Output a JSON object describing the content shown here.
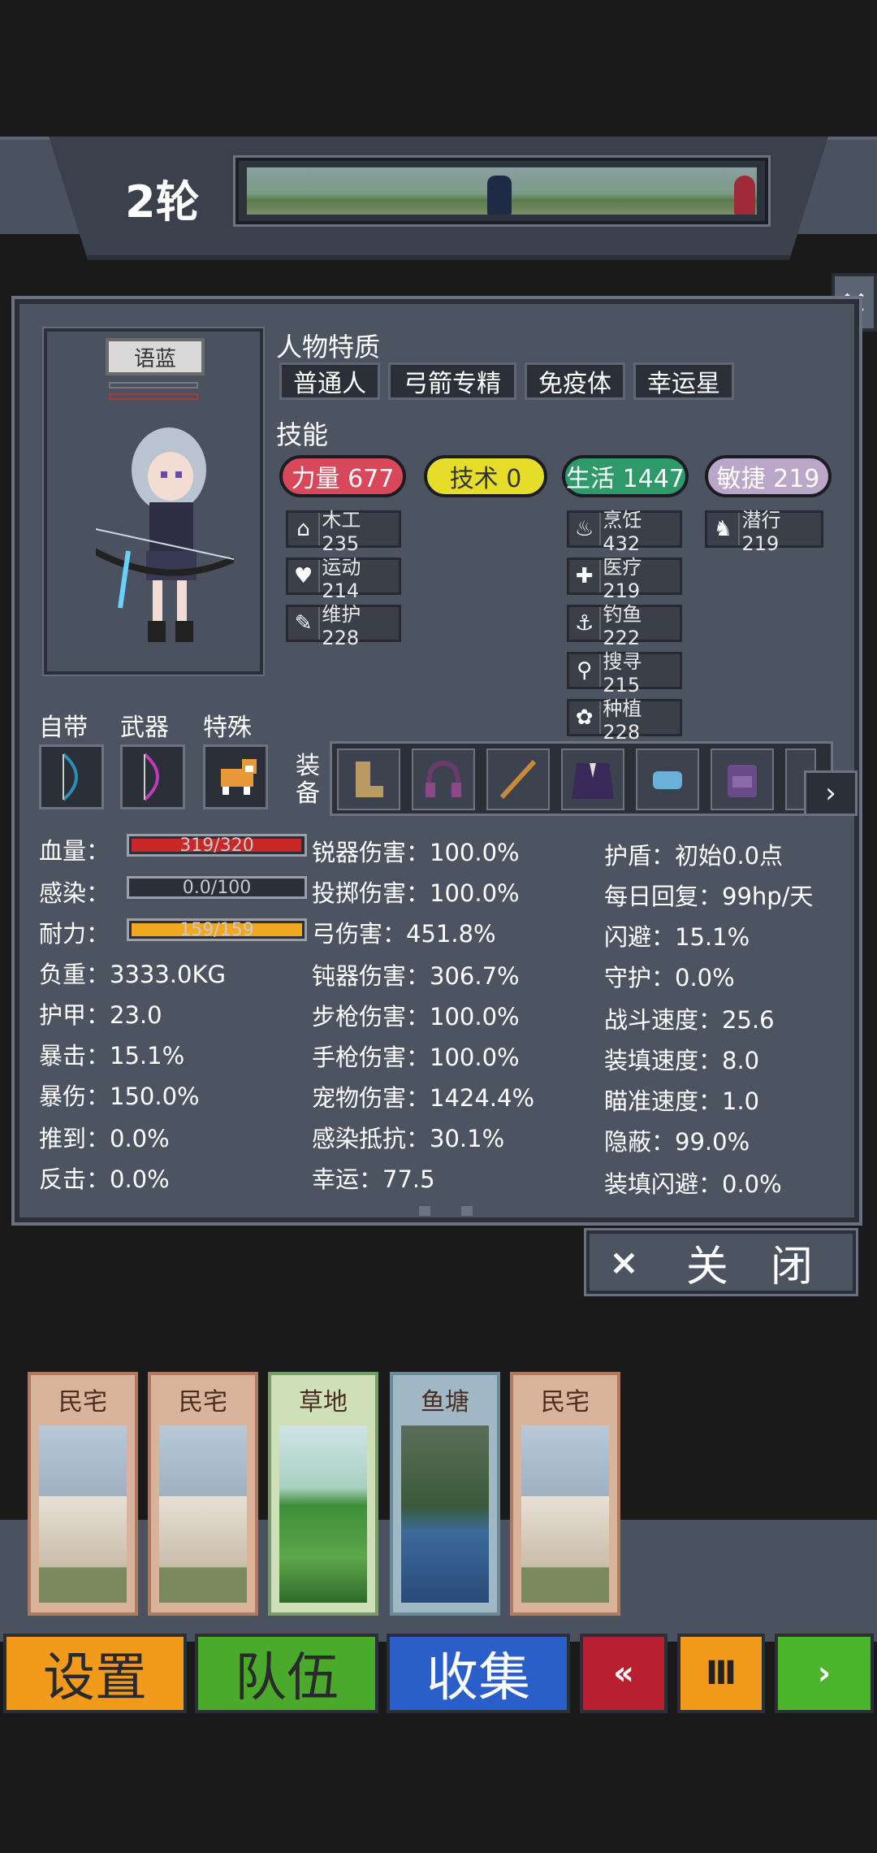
{
  "top": {
    "round_label": "2轮"
  },
  "panel": {
    "close_icon": "×",
    "character_name": "语蓝",
    "traits_title": "人物特质",
    "traits": [
      "普通人",
      "弓箭专精",
      "免疫体",
      "幸运星"
    ],
    "skills_title": "技能",
    "skill_groups": [
      {
        "label": "力量 677",
        "color": "#d9485a"
      },
      {
        "label": "技术 0",
        "color": "#e6dc2a"
      },
      {
        "label": "生活 1447",
        "color": "#2e9a6a"
      },
      {
        "label": "敏捷 219",
        "color": "#b9a6c8"
      }
    ],
    "sub_skills": [
      {
        "icon": "⌂",
        "label": "木工 235"
      },
      {
        "icon": "♥",
        "label": "运动 214"
      },
      {
        "icon": "✎",
        "label": "维护 228"
      },
      {
        "icon": "♨",
        "label": "烹饪 432"
      },
      {
        "icon": "✚",
        "label": "医疗 219"
      },
      {
        "icon": "⚓",
        "label": "钓鱼 222"
      },
      {
        "icon": "⚲",
        "label": "搜寻 215"
      },
      {
        "icon": "✿",
        "label": "种植 228"
      },
      {
        "icon": "♞",
        "label": "潜行 219"
      }
    ],
    "slot_labels": [
      "自带",
      "武器",
      "特殊"
    ],
    "equip_label": "装备",
    "stats_left": [
      {
        "label": "血量：",
        "bar": "319/320",
        "ratio": 0.997,
        "color": "#c82828"
      },
      {
        "label": "感染：",
        "bar": "0.0/100",
        "ratio": 0.0,
        "color": "#666666"
      },
      {
        "label": "耐力：",
        "bar": "159/159",
        "ratio": 1.0,
        "color": "#f0a820"
      }
    ],
    "stats_left_text": [
      "负重：3333.0KG",
      "护甲：23.0",
      "暴击：15.1%",
      "暴伤：150.0%",
      "推到：0.0%",
      "反击：0.0%"
    ],
    "stats_mid": [
      "锐器伤害：100.0%",
      "投掷伤害：100.0%",
      "弓伤害：451.8%",
      "钝器伤害：306.7%",
      "步枪伤害：100.0%",
      "手枪伤害：100.0%",
      "宠物伤害：1424.4%",
      "感染抵抗：30.1%",
      "幸运：77.5"
    ],
    "stats_right": [
      "护盾：初始0.0点",
      "每日回复：99hp/天",
      "闪避：15.1%",
      "守护：0.0%",
      "战斗速度：25.6",
      "装填速度：8.0",
      "瞄准速度：1.0",
      "隐蔽：99.0%",
      "装填闪避：0.0%"
    ],
    "next_icon": "›"
  },
  "close_button": {
    "icon": "×",
    "label": "关　闭"
  },
  "cards": [
    "民宅",
    "民宅",
    "草地",
    "鱼塘",
    "民宅"
  ],
  "menu": {
    "settings": "设置",
    "team": "队伍",
    "collect": "收集",
    "rewind": "«",
    "pause": "Ⅲ",
    "play": "›"
  }
}
